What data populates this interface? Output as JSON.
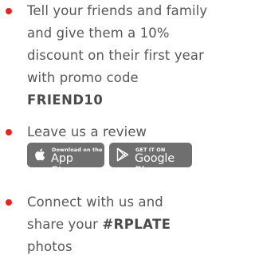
{
  "colors": {
    "bullet": "#e8241c",
    "text": "#565656",
    "badge_background": "#6f6f6f"
  },
  "items": [
    {
      "text_before": "Tell your friends and family and give them a 10% discount on their first year with promo code ",
      "bold": "FRIEND10"
    },
    {
      "text_before": "Leave us a review",
      "badges": [
        {
          "icon": "apple-icon",
          "small": "Download on the",
          "big": "App Store"
        },
        {
          "icon": "google-play-icon",
          "small": "GET IT ON",
          "big": "Google Play"
        }
      ]
    },
    {
      "text_before": "Connect with us and share your ",
      "bold": "#RPLATE",
      "text_after": " photos"
    }
  ]
}
